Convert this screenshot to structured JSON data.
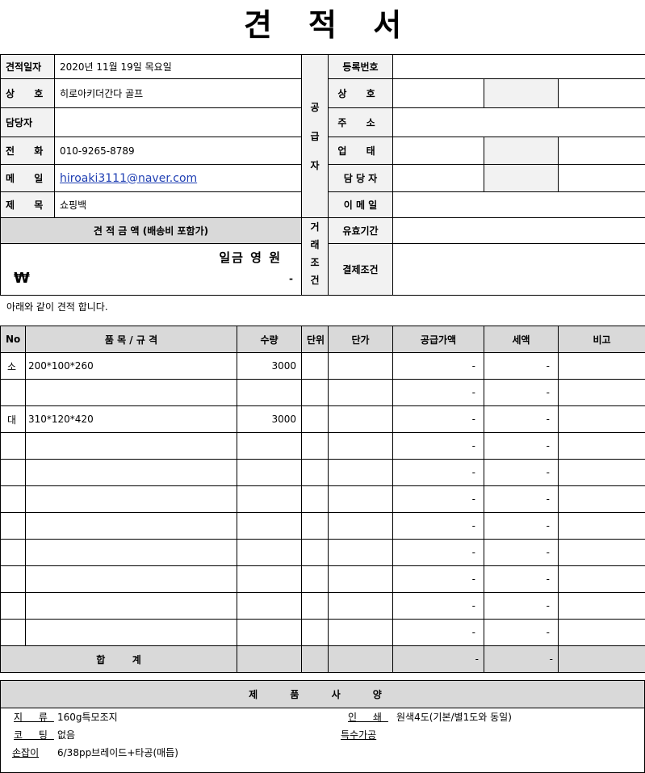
{
  "title": "견 적 서",
  "client": {
    "date_label": "견적일자",
    "date": "2020년 11월 19일 목요일",
    "company_label": "상  호",
    "company": "히로아키더간다 골프",
    "manager_label": "담당자",
    "manager": "",
    "phone_label": "전  화",
    "phone": "010-9265-8789",
    "email_label": "메  일",
    "email": "hiroaki3111@naver.com",
    "subject_label": "제  목",
    "subject": "쇼핑백"
  },
  "supplier": {
    "section_label": "공 급 자",
    "reg_label": "등록번호",
    "company_label": "상  호",
    "address_label": "주  소",
    "business_label": "업  태",
    "manager_label": "담 당 자",
    "email_label": "이 메 일"
  },
  "amount": {
    "header": "견 적 금 액 (배송비 포함가)",
    "korean_label": "일금 영 원",
    "currency_symbol": "₩",
    "value": "-"
  },
  "terms": {
    "section_label": "거 래 조 건",
    "validity_label": "유효기간",
    "payment_label": "결제조건"
  },
  "note": "아래와 같이 견적 합니다.",
  "items_table": {
    "headers": [
      "No",
      "품 목 / 규 격",
      "수량",
      "단위",
      "단가",
      "공급가액",
      "세액",
      "비고"
    ],
    "rows": [
      {
        "no": "소",
        "item": "200*100*260",
        "qty": "3000",
        "unit": "",
        "price": "",
        "supply": "-",
        "tax": "-",
        "note": ""
      },
      {
        "no": "",
        "item": "",
        "qty": "",
        "unit": "",
        "price": "",
        "supply": "-",
        "tax": "-",
        "note": ""
      },
      {
        "no": "대",
        "item": "310*120*420",
        "qty": "3000",
        "unit": "",
        "price": "",
        "supply": "-",
        "tax": "-",
        "note": ""
      },
      {
        "no": "",
        "item": "",
        "qty": "",
        "unit": "",
        "price": "",
        "supply": "-",
        "tax": "-",
        "note": ""
      },
      {
        "no": "",
        "item": "",
        "qty": "",
        "unit": "",
        "price": "",
        "supply": "-",
        "tax": "-",
        "note": ""
      },
      {
        "no": "",
        "item": "",
        "qty": "",
        "unit": "",
        "price": "",
        "supply": "-",
        "tax": "-",
        "note": ""
      },
      {
        "no": "",
        "item": "",
        "qty": "",
        "unit": "",
        "price": "",
        "supply": "-",
        "tax": "-",
        "note": ""
      },
      {
        "no": "",
        "item": "",
        "qty": "",
        "unit": "",
        "price": "",
        "supply": "-",
        "tax": "-",
        "note": ""
      },
      {
        "no": "",
        "item": "",
        "qty": "",
        "unit": "",
        "price": "",
        "supply": "-",
        "tax": "-",
        "note": ""
      },
      {
        "no": "",
        "item": "",
        "qty": "",
        "unit": "",
        "price": "",
        "supply": "-",
        "tax": "-",
        "note": ""
      },
      {
        "no": "",
        "item": "",
        "qty": "",
        "unit": "",
        "price": "",
        "supply": "-",
        "tax": "-",
        "note": ""
      }
    ],
    "total_label": "합        계",
    "total_supply": "-",
    "total_tax": "-"
  },
  "spec": {
    "header": "제 품 사 양",
    "paper_label": "지 류",
    "paper": "160g특모조지",
    "coating_label": "코 팅",
    "coating": "없음",
    "handle_label": "손잡이",
    "handle": "6/38pp브레이드+타공(매듭)",
    "print_label": "인 쇄",
    "print": "원색4도(기본/별1도와 동일)",
    "special_label": "특수가공",
    "special": ""
  }
}
